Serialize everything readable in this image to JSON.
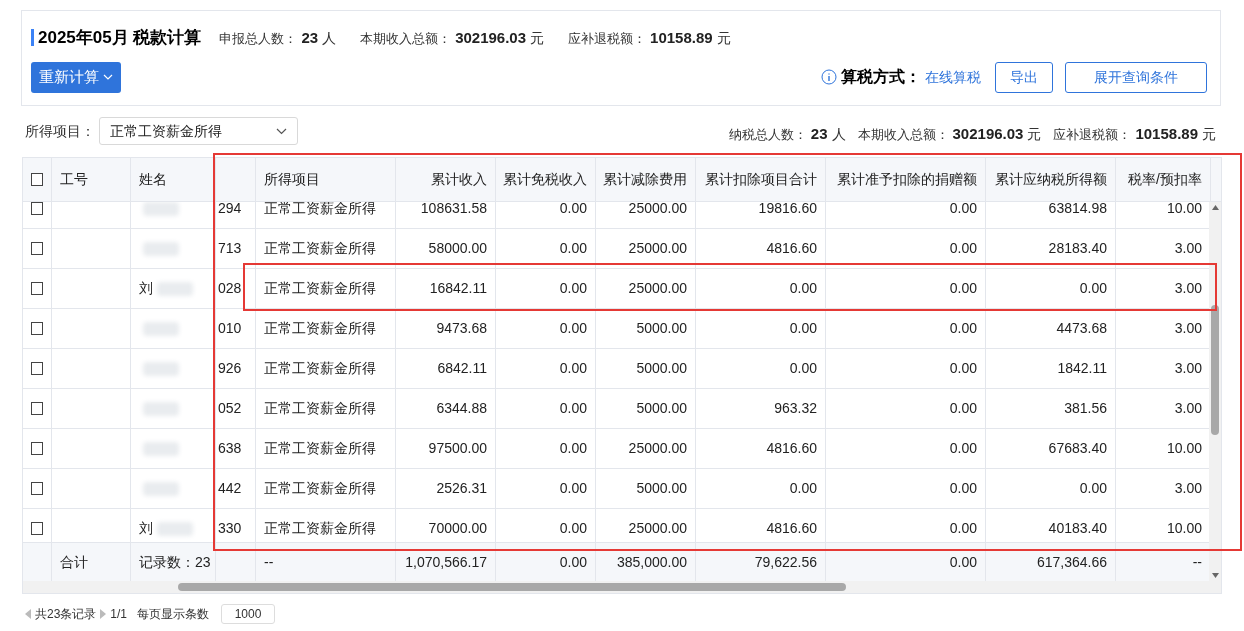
{
  "header": {
    "period": "2025年05月",
    "title": "税款计算",
    "stats": [
      {
        "label": "申报总人数：",
        "value": "23",
        "unit": "人"
      },
      {
        "label": "本期收入总额：",
        "value": "302196.03",
        "unit": "元"
      },
      {
        "label": "应补退税额：",
        "value": "10158.89",
        "unit": "元"
      }
    ],
    "recalc_button": "重新计算",
    "method_label": "算税方式：",
    "method_link": "在线算税",
    "buttons": [
      "导出",
      "展开查询条件"
    ]
  },
  "filter": {
    "label": "所得项目：",
    "value": "正常工资薪金所得",
    "stats": [
      {
        "label": "纳税总人数：",
        "value": "23",
        "unit": "人"
      },
      {
        "label": "本期收入总额：",
        "value": "302196.03",
        "unit": "元"
      },
      {
        "label": "应补退税额：",
        "value": "10158.89",
        "unit": "元"
      }
    ]
  },
  "table": {
    "header_checked": false,
    "columns": [
      {
        "label": "工号"
      },
      {
        "label": "姓名"
      },
      {},
      {
        "label": "所得项目"
      },
      {
        "label": "累计收入"
      },
      {
        "label": "累计免税收入"
      },
      {
        "label": "累计减除费用"
      },
      {
        "label": "累计扣除项目合计"
      },
      {
        "label": "累计准予扣除的捐赠额"
      },
      {
        "label": "累计应纳税所得额"
      },
      {
        "label": "税率/预扣率"
      }
    ],
    "rows": [
      {
        "checked": false,
        "code": "294",
        "item": "正常工资薪金所得",
        "values": [
          "108631.58",
          "0.00",
          "25000.00",
          "19816.60",
          "0.00",
          "63814.98",
          "10.00"
        ]
      },
      {
        "checked": false,
        "code": "713",
        "item": "正常工资薪金所得",
        "values": [
          "58000.00",
          "0.00",
          "25000.00",
          "4816.60",
          "0.00",
          "28183.40",
          "3.00"
        ]
      },
      {
        "checked": false,
        "highlighted": true,
        "name": "刘",
        "code": "028",
        "item": "正常工资薪金所得",
        "values": [
          "16842.11",
          "0.00",
          "25000.00",
          "0.00",
          "0.00",
          "0.00",
          "3.00"
        ]
      },
      {
        "checked": false,
        "code": "010",
        "item": "正常工资薪金所得",
        "values": [
          "9473.68",
          "0.00",
          "5000.00",
          "0.00",
          "0.00",
          "4473.68",
          "3.00"
        ]
      },
      {
        "checked": false,
        "code": "926",
        "item": "正常工资薪金所得",
        "values": [
          "6842.11",
          "0.00",
          "5000.00",
          "0.00",
          "0.00",
          "1842.11",
          "3.00"
        ]
      },
      {
        "checked": false,
        "code": "052",
        "item": "正常工资薪金所得",
        "values": [
          "6344.88",
          "0.00",
          "5000.00",
          "963.32",
          "0.00",
          "381.56",
          "3.00"
        ]
      },
      {
        "checked": false,
        "code": "638",
        "item": "正常工资薪金所得",
        "values": [
          "97500.00",
          "0.00",
          "25000.00",
          "4816.60",
          "0.00",
          "67683.40",
          "10.00"
        ]
      },
      {
        "checked": false,
        "code": "442",
        "item": "正常工资薪金所得",
        "values": [
          "2526.31",
          "0.00",
          "5000.00",
          "0.00",
          "0.00",
          "0.00",
          "3.00"
        ]
      },
      {
        "checked": false,
        "name": "刘",
        "code": "330",
        "item": "正常工资薪金所得",
        "values": [
          "70000.00",
          "0.00",
          "25000.00",
          "4816.60",
          "0.00",
          "40183.40",
          "10.00"
        ]
      }
    ],
    "total": {
      "label": "合计",
      "count": "记录数：23",
      "item": "--",
      "values": [
        "1,070,566.17",
        "0.00",
        "385,000.00",
        "79,622.56",
        "0.00",
        "617,364.66",
        "--"
      ]
    }
  },
  "columns_highlighted": true,
  "pagination": {
    "records": "共23条记录",
    "pages": "1/1",
    "page_size_label": "每页显示条数",
    "page_size": "1000"
  }
}
